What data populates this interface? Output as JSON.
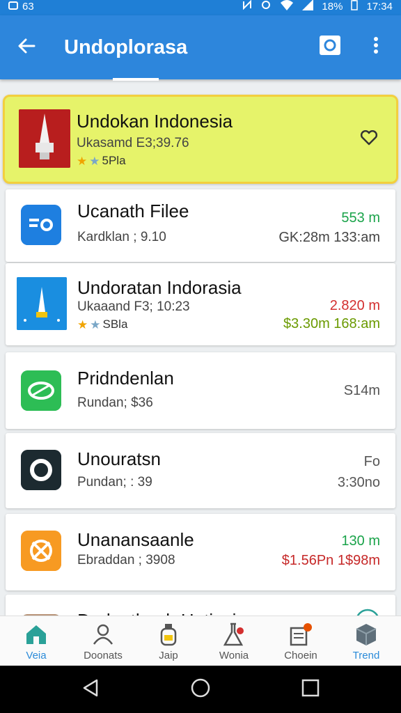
{
  "status_bar": {
    "left_text": "63",
    "battery": "18%",
    "time": "17:34"
  },
  "app_bar": {
    "title": "Undoplorasa",
    "back_icon": "arrow-left-icon",
    "action_icon": "camera-icon",
    "overflow_icon": "more-vert-icon"
  },
  "items": [
    {
      "title": "Undokan Indonesia",
      "subtitle": "Ukasamd E3;39.76",
      "rating_text": "5Pla",
      "icon": "monument-thumbnail",
      "trailing_icon": "heart-outline-icon",
      "featured": true
    },
    {
      "title": "Ucanath Filee",
      "subtitle": "Kardklan ; 9.10",
      "value_top": "553 m",
      "value_bottom": "GK:28m 133:am",
      "icon": "eo-app-icon",
      "value_top_color": "#1aa34a",
      "value_bottom_color": "#444444"
    },
    {
      "title": "Undoratan Indorasia",
      "subtitle": "Ukaaand F3; 10:23",
      "rating_text": "SBla",
      "value_top": "2.820 m",
      "value_bottom": "$3.30m 168:am",
      "icon": "monument-app-icon",
      "value_top_color": "#d32f2f",
      "value_bottom_color": "#6a9a00"
    },
    {
      "title": "Pridndenlan",
      "subtitle": "Rundan; $36",
      "value_top": "S14m",
      "icon": "leaf-app-icon",
      "value_top_color": "#555555"
    },
    {
      "title": "Unouratsn",
      "subtitle": "Pundan; : 39",
      "value_top": "Fo",
      "value_bottom": "3:30no",
      "icon": "ring-app-icon",
      "value_top_color": "#555555",
      "value_bottom_color": "#555555"
    },
    {
      "title": "Unanansaanle",
      "subtitle": "Ebraddan ; 3908",
      "value_top": "130 m",
      "value_bottom": "$1.56Pn 1$98m",
      "icon": "crossed-app-icon",
      "value_top_color": "#1aa34a",
      "value_bottom_color": "#c62828"
    },
    {
      "title": "Dndnathanh Hatiusia",
      "icon": "person-photo-thumbnail",
      "trailing_icon": "location-badge-icon"
    }
  ],
  "bottom_nav": [
    {
      "label": "Veia",
      "icon": "home-icon",
      "active": true
    },
    {
      "label": "Doonats",
      "icon": "people-icon",
      "active": false
    },
    {
      "label": "Jaip",
      "icon": "bottle-icon",
      "active": false
    },
    {
      "label": "Wonia",
      "icon": "flask-icon",
      "active": false
    },
    {
      "label": "Choein",
      "icon": "notes-badge-icon",
      "active": false
    },
    {
      "label": "Trend",
      "icon": "box-icon",
      "active": true
    }
  ],
  "system_nav": [
    "back-triangle-icon",
    "home-circle-icon",
    "recents-square-icon"
  ],
  "colors": {
    "app_bar": "#2d86dc",
    "accent": "#2b8bd9",
    "featured_bg": "#e6f36a",
    "featured_border": "#f3cf3e"
  }
}
